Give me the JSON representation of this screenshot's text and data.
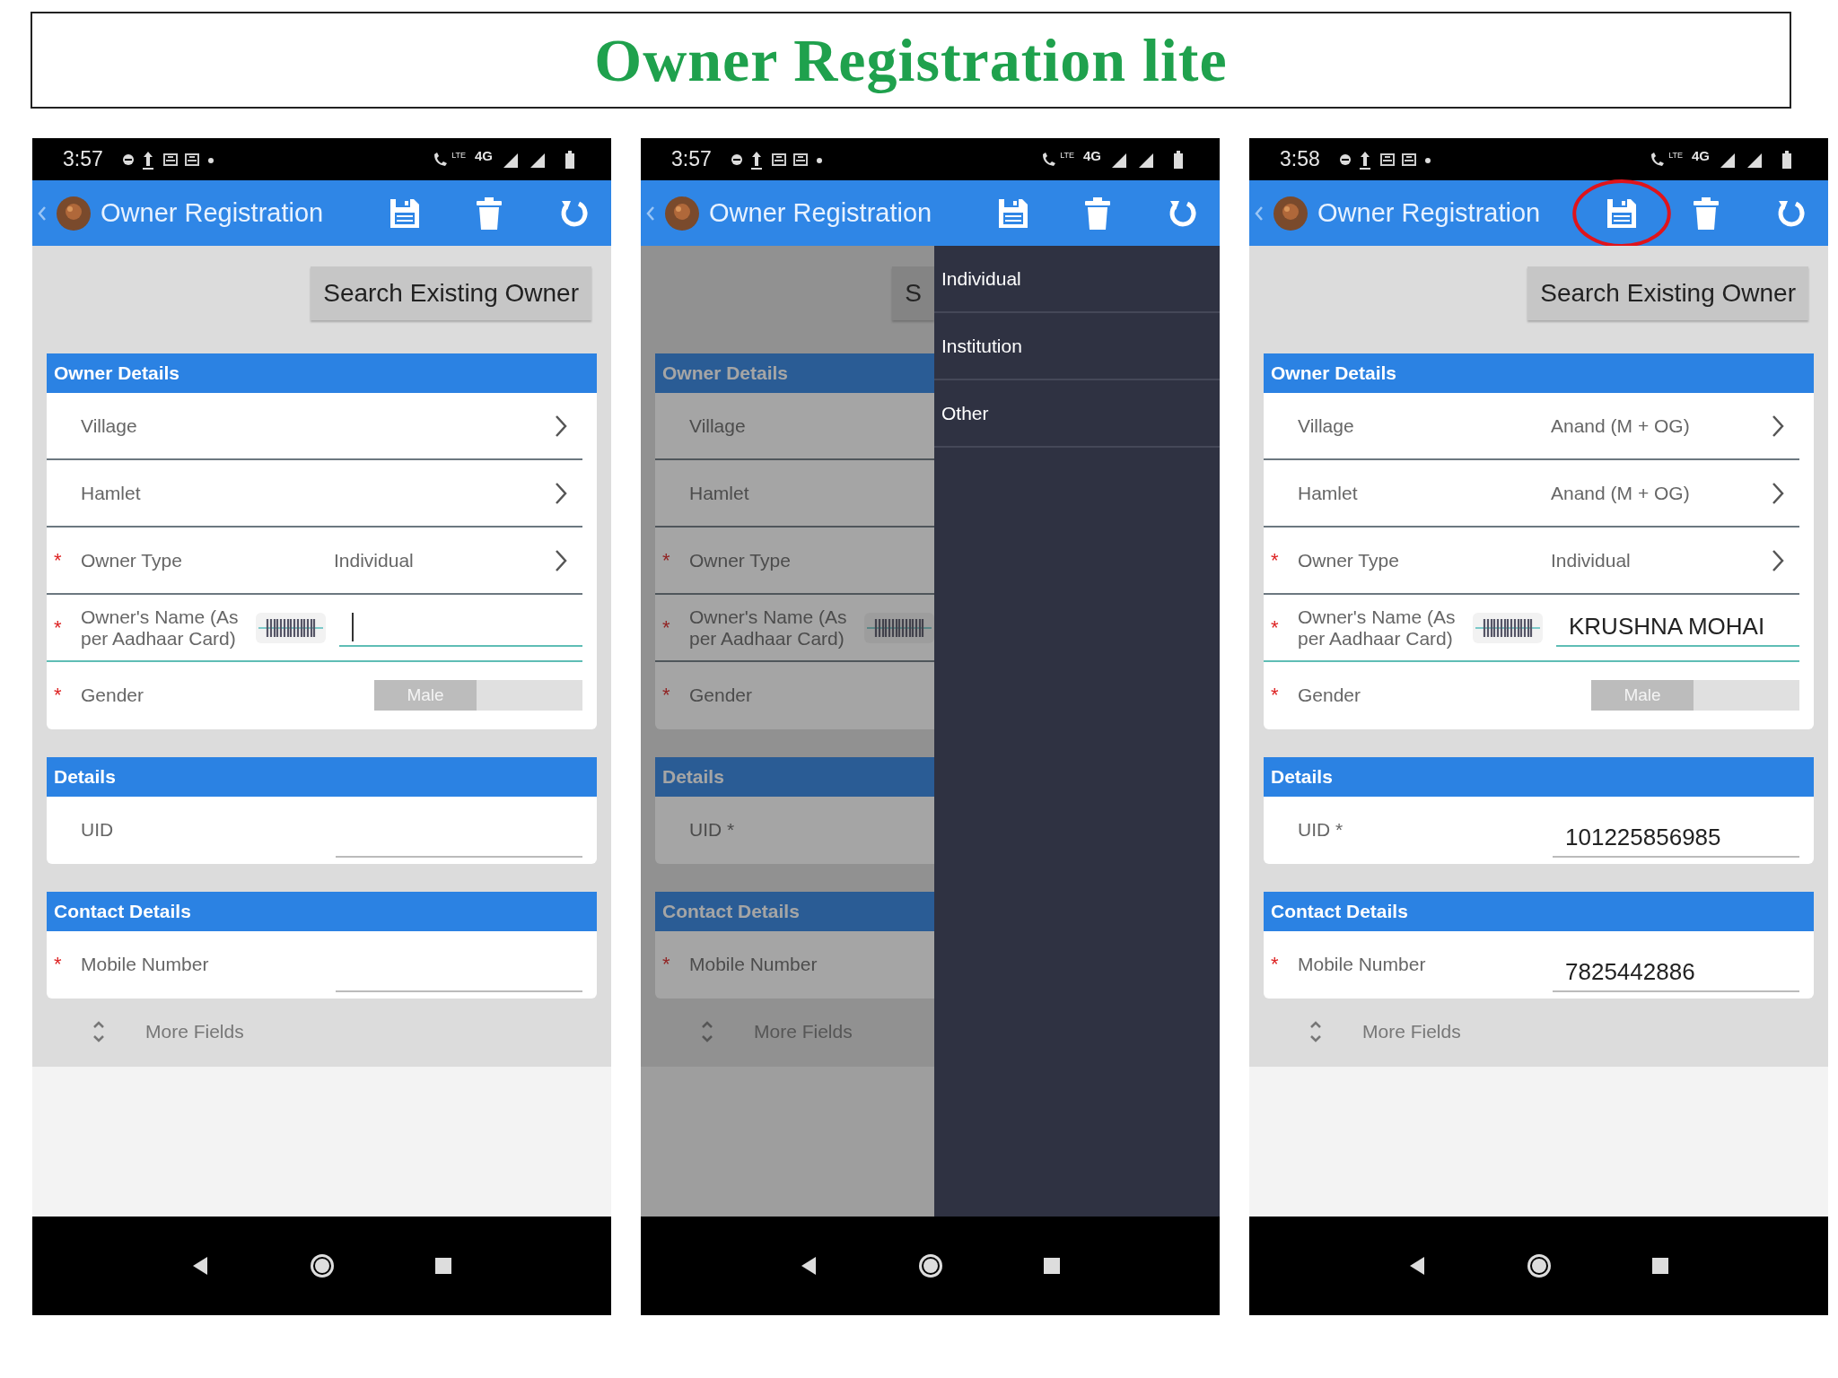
{
  "title": "Owner Registration lite",
  "phones": [
    {
      "time": "3:57",
      "call_tag": "LTE",
      "network": "4G",
      "app_title": "Owner Registration",
      "save_circled": false,
      "search_button": "Search Existing Owner",
      "sections": [
        {
          "title": "Owner Details",
          "fields": [
            {
              "kind": "picker",
              "label": "Village"
            },
            {
              "kind": "picker",
              "label": "Hamlet"
            },
            {
              "kind": "picker",
              "required": "*",
              "label": "Owner Type",
              "value": "Individual"
            },
            {
              "kind": "name",
              "required": "*",
              "label": "Owner's Name (As per Aadhaar Card)",
              "focused": true
            },
            {
              "kind": "toggle",
              "required": "*",
              "label": "Gender",
              "value": "Male"
            }
          ]
        },
        {
          "title": "Details",
          "fields": [
            {
              "kind": "text",
              "label": "UID",
              "focused": false
            }
          ]
        },
        {
          "title": "Contact Details",
          "fields": [
            {
              "kind": "text",
              "required": "*",
              "label": "Mobile Number",
              "focused": false
            }
          ]
        }
      ],
      "more": "More Fields"
    },
    {
      "time": "3:57",
      "call_tag": "LTE",
      "network": "4G",
      "app_title": "Owner Registration",
      "save_circled": false,
      "search_button": "S",
      "sections": [
        {
          "title": "Owner Details",
          "fields": [
            {
              "kind": "picker",
              "label": "Village"
            },
            {
              "kind": "picker",
              "label": "Hamlet"
            },
            {
              "kind": "picker",
              "required": "*",
              "label": "Owner Type"
            },
            {
              "kind": "name",
              "required": "*",
              "label": "Owner's Name (As per Aadhaar Card)"
            },
            {
              "kind": "toggle",
              "required": "*",
              "label": "Gender"
            }
          ]
        },
        {
          "title": "Details",
          "fields": [
            {
              "kind": "text",
              "label": "UID *"
            }
          ]
        },
        {
          "title": "Contact Details",
          "fields": [
            {
              "kind": "text",
              "required": "*",
              "label": "Mobile Number"
            }
          ]
        }
      ],
      "more": "More Fields",
      "menu": [
        {
          "label": "Individual",
          "selected": false
        },
        {
          "label": "Institution",
          "selected": false
        },
        {
          "label": "Other",
          "selected": false
        }
      ]
    },
    {
      "time": "3:58",
      "call_tag": "LTE",
      "network": "4G",
      "app_title": "Owner Registration",
      "save_circled": true,
      "search_button": "Search Existing Owner",
      "sections": [
        {
          "title": "Owner Details",
          "fields": [
            {
              "kind": "picker",
              "label": "Village",
              "value": "Anand (M + OG)"
            },
            {
              "kind": "picker",
              "label": "Hamlet",
              "value": "Anand (M + OG)"
            },
            {
              "kind": "picker",
              "required": "*",
              "label": "Owner Type",
              "value": "Individual"
            },
            {
              "kind": "name",
              "required": "*",
              "label": "Owner's Name (As per Aadhaar Card)",
              "value": "KRUSHNA MOHAI",
              "focused": true
            },
            {
              "kind": "toggle",
              "required": "*",
              "label": "Gender",
              "value": "Male"
            }
          ]
        },
        {
          "title": "Details",
          "fields": [
            {
              "kind": "text",
              "label": "UID *",
              "value": "101225856985",
              "focused": false
            }
          ]
        },
        {
          "title": "Contact Details",
          "fields": [
            {
              "kind": "text",
              "required": "*",
              "label": "Mobile Number",
              "value": "7825442886",
              "focused": false
            }
          ]
        }
      ],
      "more": "More Fields"
    }
  ]
}
